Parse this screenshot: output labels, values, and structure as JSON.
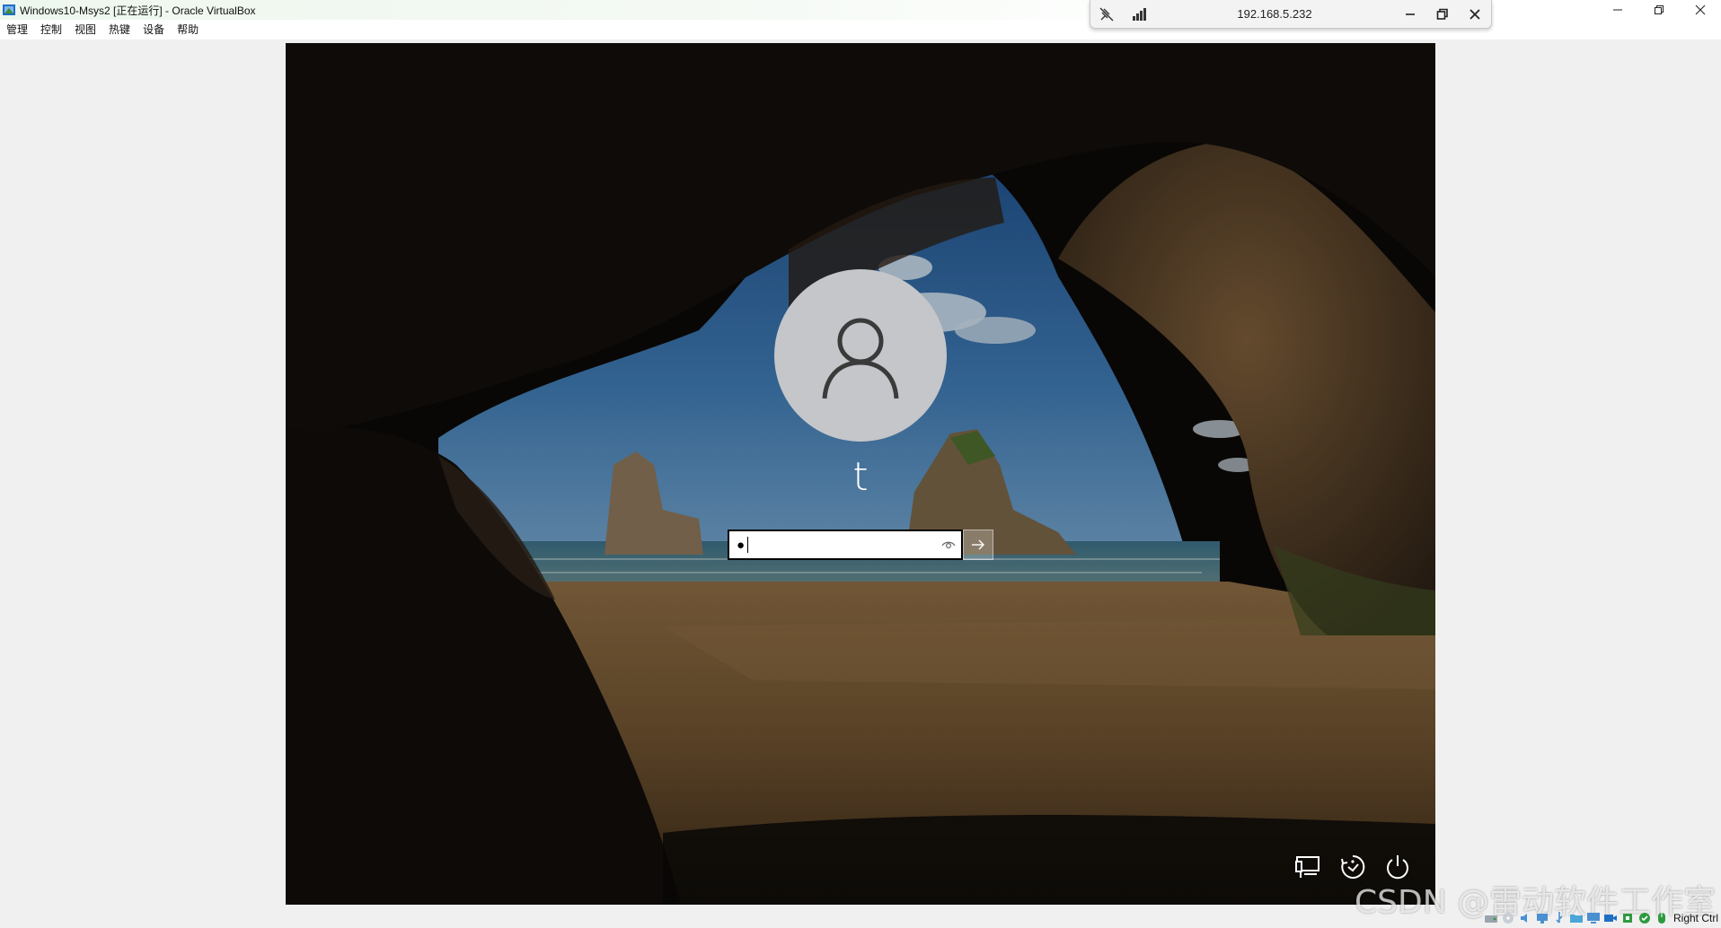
{
  "window": {
    "title": "Windows10-Msys2 [正在运行] - Oracle VirtualBox"
  },
  "menu": [
    "管理",
    "控制",
    "视图",
    "热键",
    "设备",
    "帮助"
  ],
  "remote_bar": {
    "ip": "192.168.5.232"
  },
  "login": {
    "username": "t",
    "password_mask": "●"
  },
  "watermark": "CSDN @雷动软件工作室",
  "statusbar": {
    "host_key": "Right Ctrl"
  },
  "colors": {
    "accent_green": "#2e9a40",
    "vbox_blue": "#1e6fc2",
    "avatar_bg": "#c4c6c9"
  }
}
